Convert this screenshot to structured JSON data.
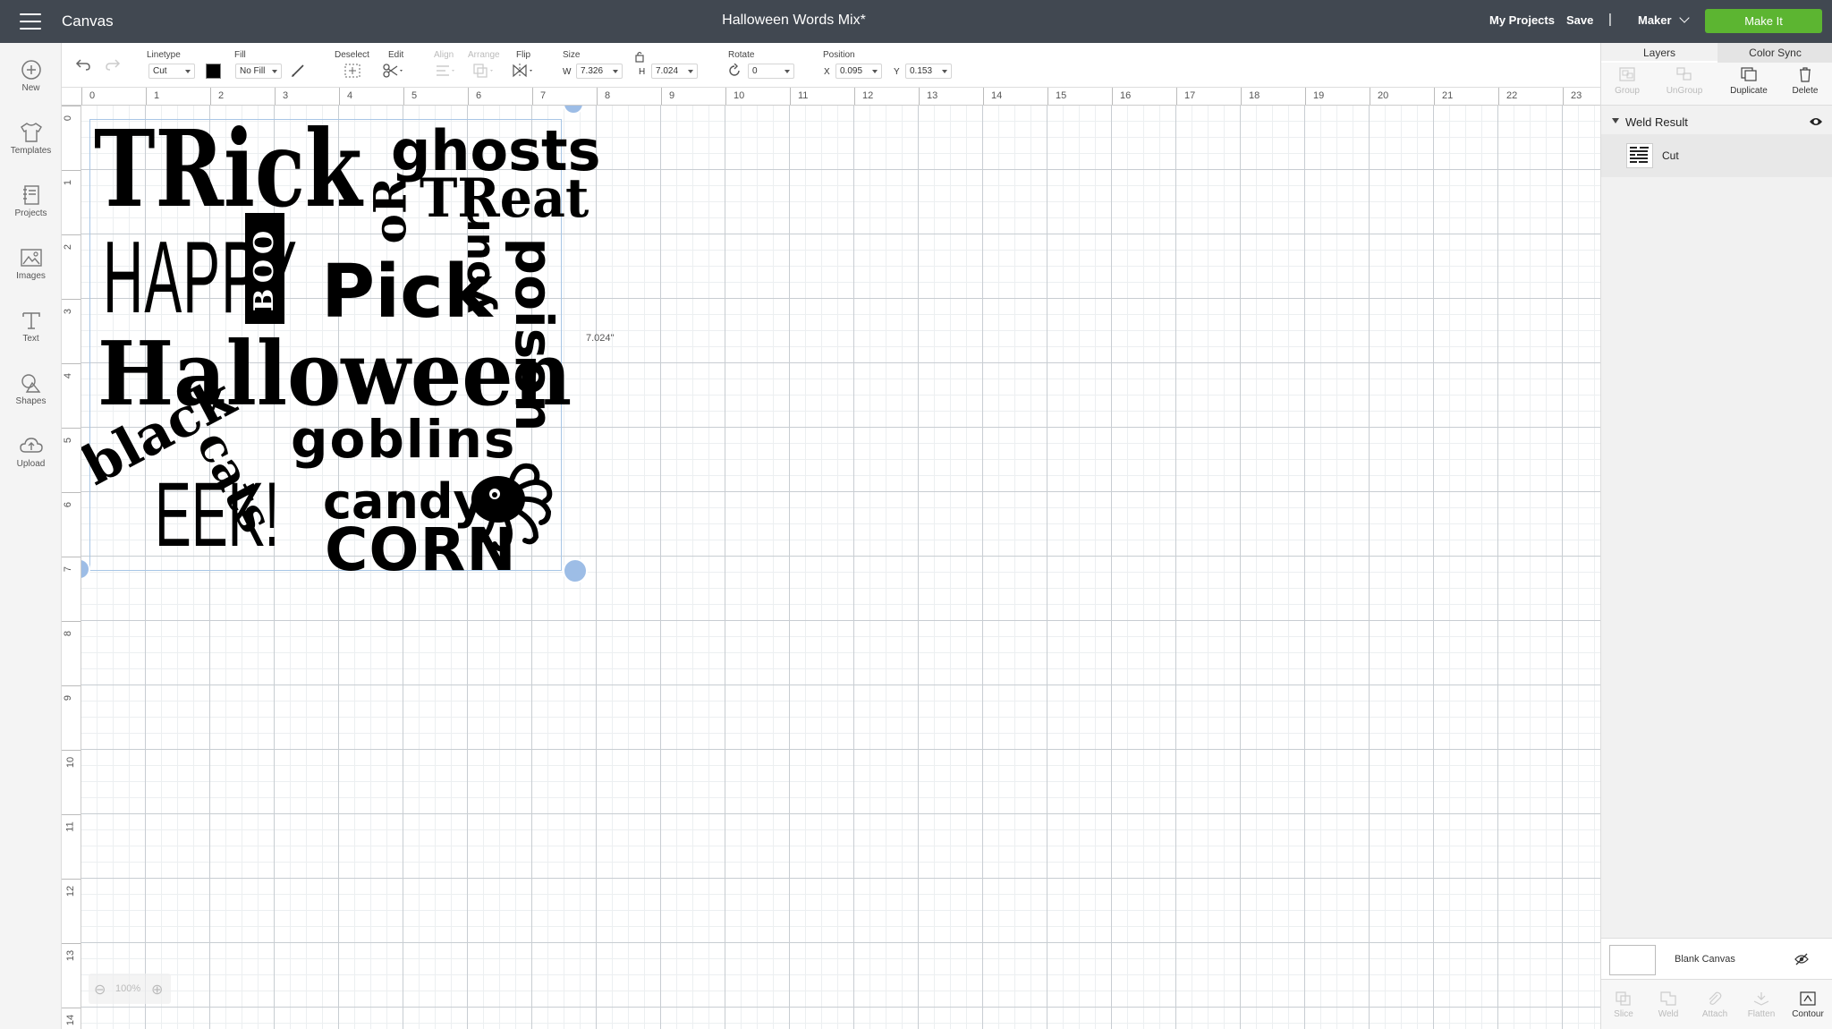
{
  "header": {
    "app_label": "Canvas",
    "title": "Halloween Words Mix*",
    "my_projects": "My Projects",
    "save": "Save",
    "separator": "|",
    "machine": "Maker",
    "make_it": "Make It"
  },
  "sidebar": {
    "items": [
      {
        "label": "New",
        "icon": "plus-circle-icon"
      },
      {
        "label": "Templates",
        "icon": "shirt-icon"
      },
      {
        "label": "Projects",
        "icon": "notebook-icon"
      },
      {
        "label": "Images",
        "icon": "image-icon"
      },
      {
        "label": "Text",
        "icon": "text-t-icon"
      },
      {
        "label": "Shapes",
        "icon": "shapes-icon"
      },
      {
        "label": "Upload",
        "icon": "cloud-upload-icon"
      }
    ]
  },
  "toolbar": {
    "linetype_label": "Linetype",
    "linetype_value": "Cut",
    "fill_label": "Fill",
    "fill_value": "No Fill",
    "deselect_label": "Deselect",
    "edit_label": "Edit",
    "align_label": "Align",
    "arrange_label": "Arrange",
    "flip_label": "Flip",
    "size_label": "Size",
    "w_label": "W",
    "w_value": "7.326",
    "h_label": "H",
    "h_value": "7.024",
    "rotate_label": "Rotate",
    "rotate_value": "0",
    "position_label": "Position",
    "x_label": "X",
    "x_value": "0.095",
    "y_label": "Y",
    "y_value": "0.153",
    "color_swatch": "#000000"
  },
  "ruler": {
    "top": [
      "0",
      "1",
      "2",
      "3",
      "4",
      "5",
      "6",
      "7",
      "8",
      "9",
      "10",
      "11",
      "12",
      "13",
      "14",
      "15",
      "16",
      "17",
      "18",
      "19",
      "20",
      "21",
      "22",
      "23"
    ],
    "left": [
      "0",
      "1",
      "2",
      "3",
      "4",
      "5",
      "6",
      "7",
      "8",
      "9",
      "10",
      "11",
      "12",
      "13",
      "14"
    ]
  },
  "canvas": {
    "height_dimension": "7.024\"",
    "zoom": "100%",
    "words": {
      "trick": "TRick",
      "ghosts": "ghosts",
      "or": "oR",
      "treat": "TReat",
      "happy": "HAPPY",
      "boo": "BOO",
      "pick": "Pick",
      "your": "your",
      "poison": "poison",
      "halloween": "Halloween",
      "goblins": "goblins",
      "black": "black",
      "cats": "cats",
      "eek": "EEK!",
      "candy": "candy",
      "corn": "CORN"
    }
  },
  "right_panel": {
    "tabs": [
      "Layers",
      "Color Sync"
    ],
    "actions": [
      {
        "label": "Group",
        "enabled": false
      },
      {
        "label": "UnGroup",
        "enabled": false
      },
      {
        "label": "Duplicate",
        "enabled": true
      },
      {
        "label": "Delete",
        "enabled": true
      }
    ],
    "group_name": "Weld Result",
    "layer_label": "Cut",
    "blank_canvas": "Blank Canvas",
    "bottom_tools": [
      {
        "label": "Slice",
        "enabled": false
      },
      {
        "label": "Weld",
        "enabled": false
      },
      {
        "label": "Attach",
        "enabled": false
      },
      {
        "label": "Flatten",
        "enabled": false
      },
      {
        "label": "Contour",
        "enabled": true
      }
    ]
  },
  "colors": {
    "topbar": "#414851",
    "make_it": "#5cb531",
    "selection": "#9dbde6"
  }
}
